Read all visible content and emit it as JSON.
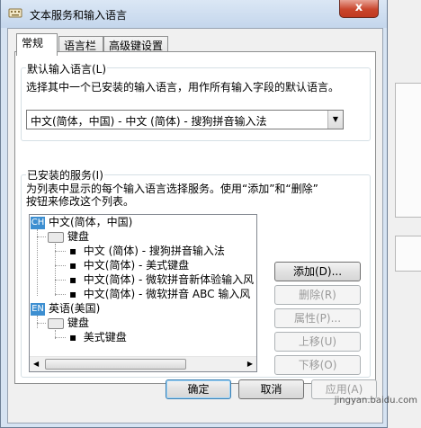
{
  "window": {
    "title": "文本服务和输入语言",
    "close_glyph": "x"
  },
  "tabs": [
    {
      "label": "常规"
    },
    {
      "label": "语言栏"
    },
    {
      "label": "高级键设置"
    }
  ],
  "default_language": {
    "group_label": "默认输入语言(L)",
    "description": "选择其中一个已安装的输入语言，用作所有输入字段的默认语言。",
    "selected": "中文(简体，中国) - 中文 (简体) - 搜狗拼音输入法"
  },
  "installed": {
    "group_label": "已安装的服务(I)",
    "description_line1": "为列表中显示的每个输入语言选择服务。使用“添加”和“删除”",
    "description_line2": "按钮来修改这个列表。",
    "tree": {
      "lang1": {
        "badge": "CH",
        "label": "中文(简体，中国)"
      },
      "lang1_keyboard": "键盘",
      "lang1_items": [
        "中文 (简体) - 搜狗拼音输入法",
        "中文(简体) - 美式键盘",
        "中文(简体) - 微软拼音新体验输入风",
        "中文(简体) - 微软拼音 ABC 输入风"
      ],
      "lang2": {
        "badge": "EN",
        "label": "英语(美国)"
      },
      "lang2_keyboard": "键盘",
      "lang2_items": [
        "美式键盘"
      ]
    },
    "buttons": {
      "add": "添加(D)...",
      "remove": "删除(R)",
      "properties": "属性(P)...",
      "move_up": "上移(U)",
      "move_down": "下移(O)"
    }
  },
  "footer": {
    "ok": "确定",
    "cancel": "取消",
    "apply": "应用(A)"
  },
  "watermark": "jingyan.baidu.com",
  "colors": {
    "lang_badge": "#3d8fd1",
    "close_button": "#c9452c"
  }
}
